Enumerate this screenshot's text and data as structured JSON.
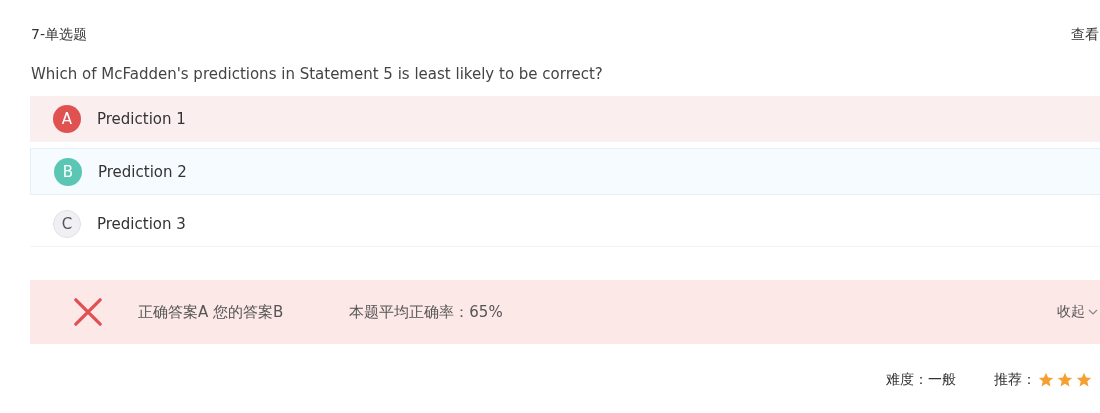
{
  "header": {
    "title": "7-单选题",
    "action": "查看"
  },
  "question": "Which of McFadden's predictions in Statement 5 is least likely to be correct?",
  "options": [
    {
      "letter": "A",
      "text": "Prediction 1",
      "correct": true,
      "selected": false
    },
    {
      "letter": "B",
      "text": "Prediction 2",
      "correct": false,
      "selected": true
    },
    {
      "letter": "C",
      "text": "Prediction 3",
      "correct": false,
      "selected": false
    }
  ],
  "result": {
    "wrong": true,
    "answer": "正确答案A 您的答案B",
    "average": "本题平均正确率：65%",
    "collapse": "收起"
  },
  "footer": {
    "difficulty": "难度：一般",
    "recommend_label": "推荐：",
    "stars": 3
  }
}
